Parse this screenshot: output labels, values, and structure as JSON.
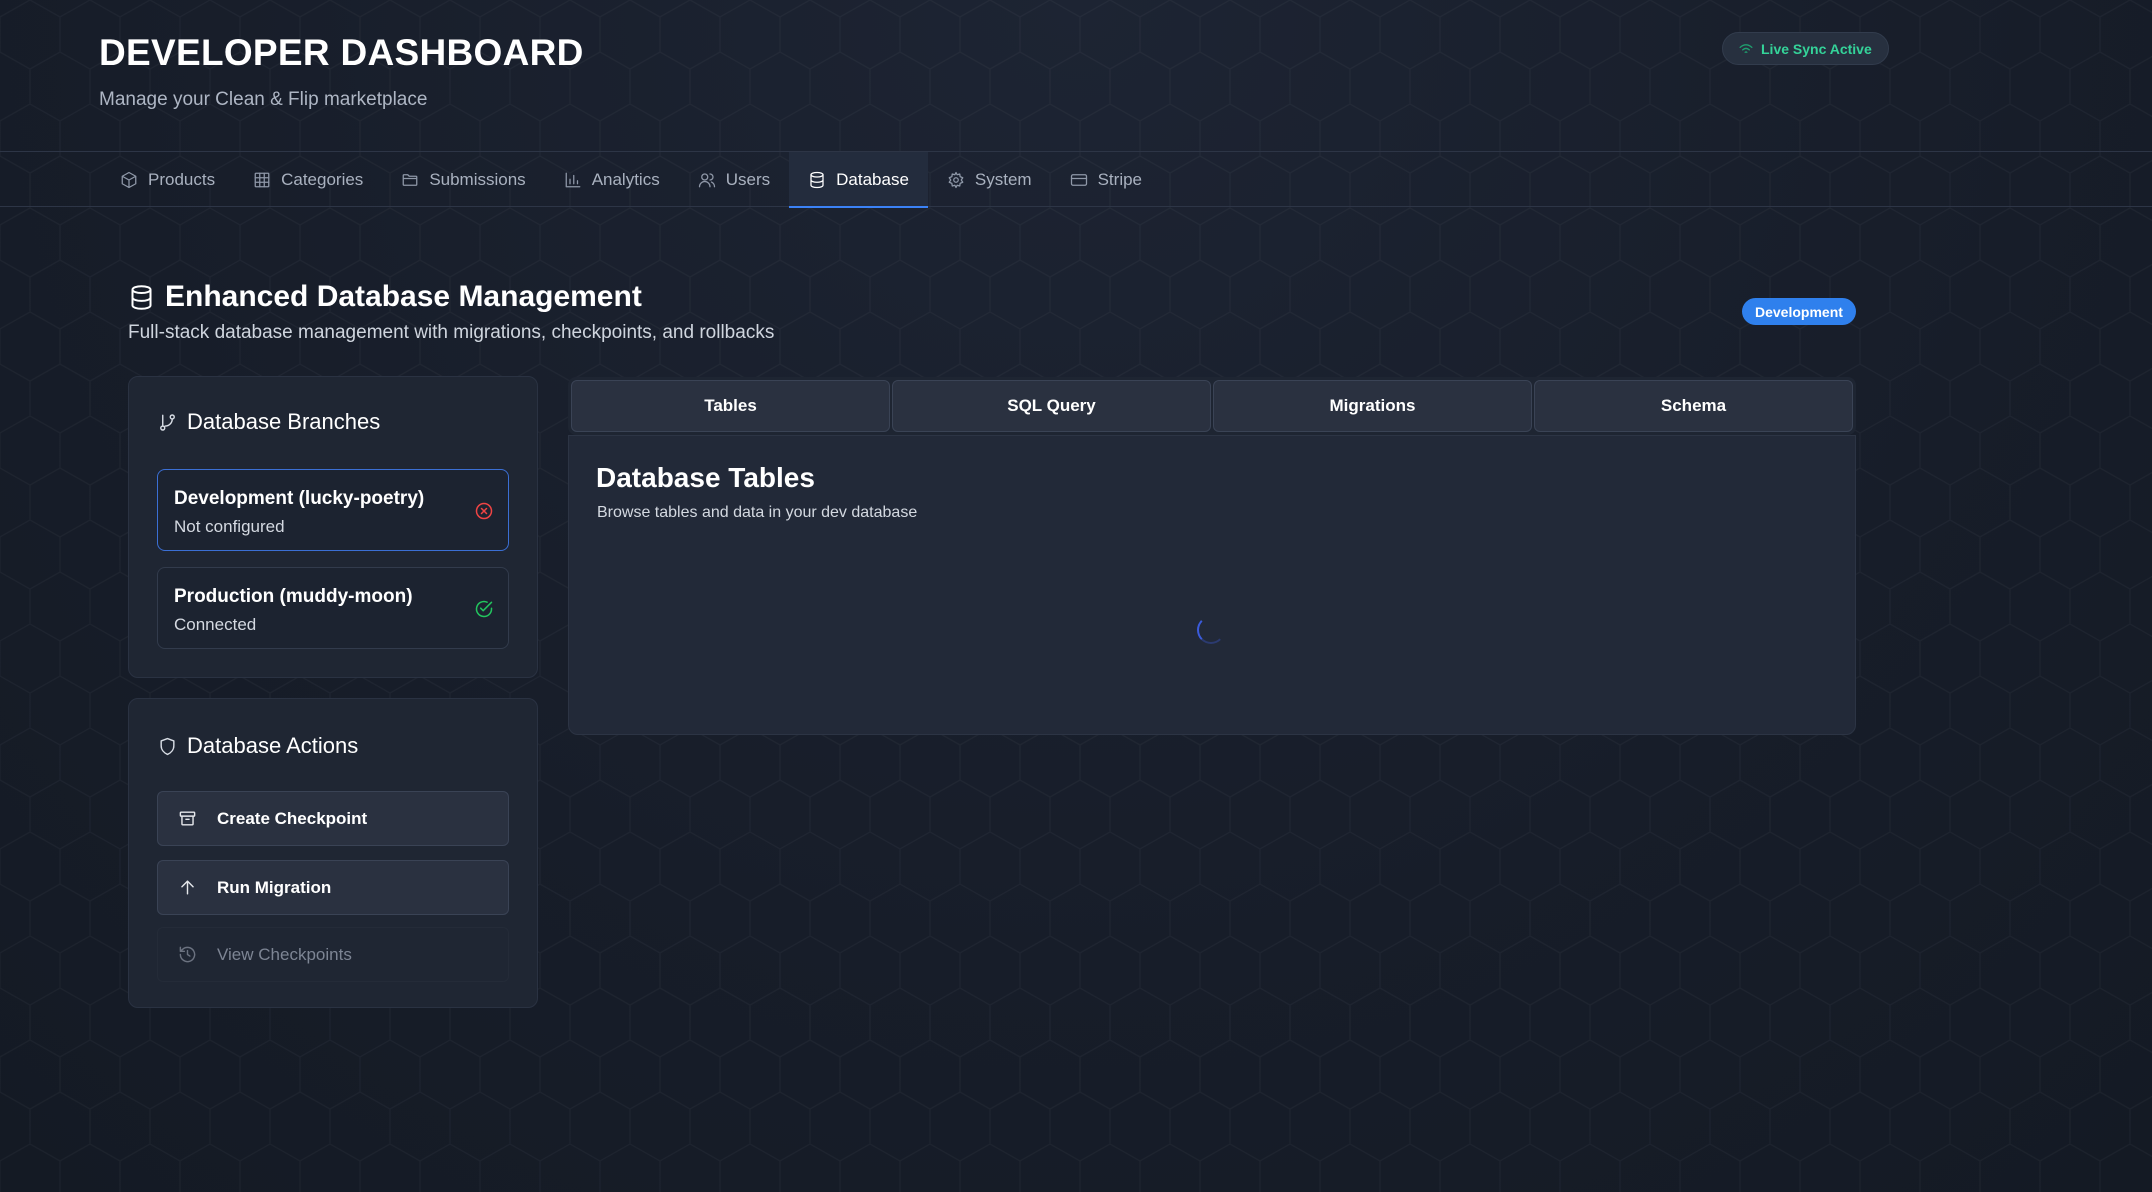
{
  "header": {
    "title": "DEVELOPER DASHBOARD",
    "subtitle": "Manage your Clean & Flip marketplace",
    "sync_status": "Live Sync Active"
  },
  "nav": {
    "items": [
      {
        "label": "Products",
        "icon": "box-icon"
      },
      {
        "label": "Categories",
        "icon": "grid-icon"
      },
      {
        "label": "Submissions",
        "icon": "folder-icon"
      },
      {
        "label": "Analytics",
        "icon": "bar-chart-icon"
      },
      {
        "label": "Users",
        "icon": "users-icon"
      },
      {
        "label": "Database",
        "icon": "database-icon",
        "active": true
      },
      {
        "label": "System",
        "icon": "gear-icon"
      },
      {
        "label": "Stripe",
        "icon": "credit-card-icon"
      }
    ]
  },
  "section": {
    "title": "Enhanced Database Management",
    "description": "Full-stack database management with migrations, checkpoints, and rollbacks",
    "env_badge": "Development"
  },
  "branches": {
    "title": "Database Branches",
    "items": [
      {
        "name": "Development (lucky-poetry)",
        "status": "Not configured",
        "state": "error",
        "selected": true
      },
      {
        "name": "Production (muddy-moon)",
        "status": "Connected",
        "state": "ok",
        "selected": false
      }
    ]
  },
  "actions": {
    "title": "Database Actions",
    "create_checkpoint": "Create Checkpoint",
    "run_migration": "Run Migration",
    "view_checkpoints": "View Checkpoints"
  },
  "tabs": [
    "Tables",
    "SQL Query",
    "Migrations",
    "Schema"
  ],
  "panel": {
    "title": "Database Tables",
    "description": "Browse tables and data in your dev database"
  },
  "colors": {
    "accent": "#3b82f6",
    "badge": "#2f80ed",
    "sync_green": "#34d399",
    "error_red": "#ef4444",
    "ok_green": "#22c55e",
    "background": "#171d29"
  }
}
